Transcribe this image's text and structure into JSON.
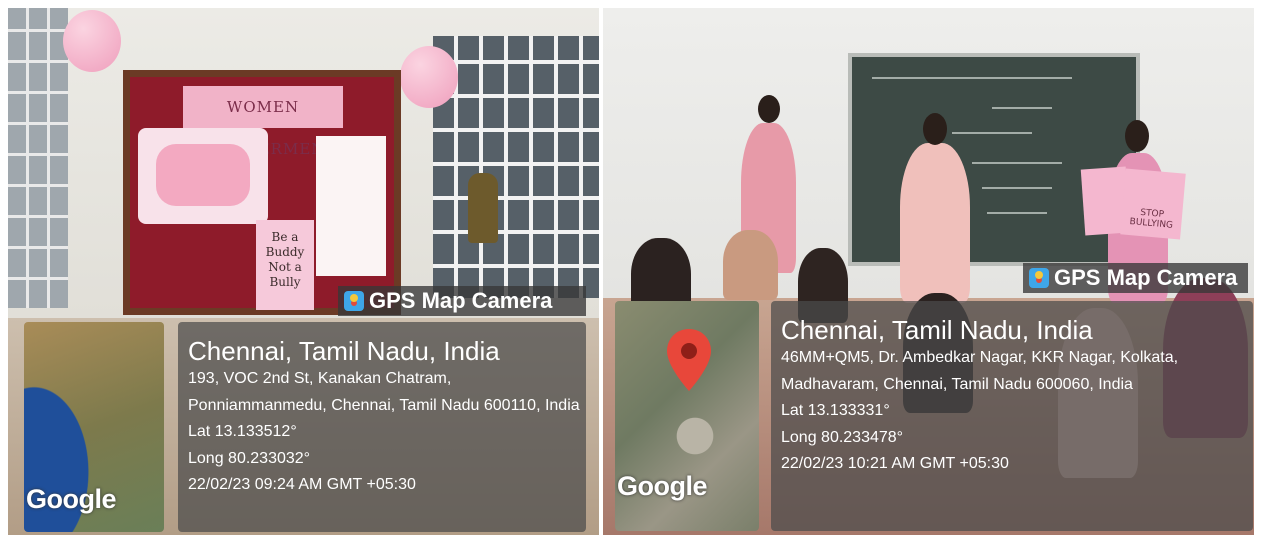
{
  "photos": [
    {
      "board_title": "WOMEN EMPOWERMENT",
      "poster_text": "Be a Buddy Not a Bully",
      "stamp": {
        "app_name": "GPS Map Camera",
        "map_brand": "Google",
        "city": "Chennai, Tamil Nadu, India",
        "address_line1": "193, VOC 2nd St, Kanakan Chatram,",
        "address_line2": "Ponniammanmedu, Chennai, Tamil Nadu 600110, India",
        "lat": "Lat 13.133512°",
        "long": "Long 80.233032°",
        "datetime": "22/02/23 09:24 AM GMT +05:30"
      }
    },
    {
      "sign_text": "STOP BULLYING",
      "stamp": {
        "app_name": "GPS Map Camera",
        "map_brand": "Google",
        "city": "Chennai, Tamil Nadu, India",
        "address_line1": "46MM+QM5, Dr. Ambedkar Nagar, KKR Nagar, Kolkata,",
        "address_line2": "Madhavaram, Chennai, Tamil Nadu 600060, India",
        "lat": "Lat 13.133331°",
        "long": "Long 80.233478°",
        "datetime": "22/02/23 10:21 AM GMT +05:30"
      }
    }
  ],
  "colors": {
    "stamp_bg": "#4b4b4b",
    "map_pin": "#e8473a",
    "board": "#8e1b2a"
  }
}
